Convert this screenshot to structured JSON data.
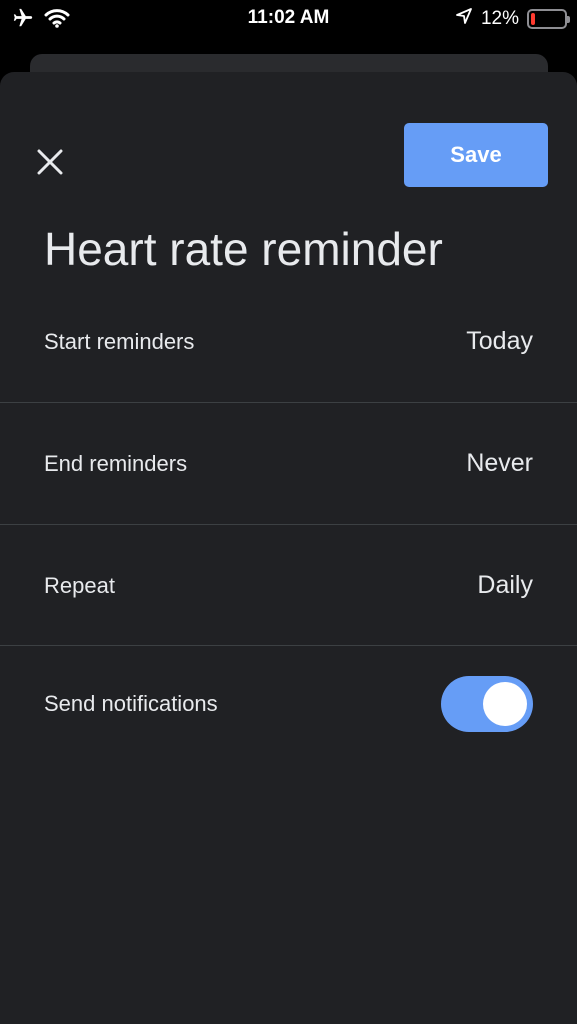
{
  "status_bar": {
    "time": "11:02 AM",
    "battery_percent": "12%",
    "battery_level": 0.12,
    "icons": [
      "airplane-icon",
      "wifi-icon",
      "location-arrow-icon",
      "battery-icon"
    ]
  },
  "header": {
    "close_icon": "close-icon",
    "save_label": "Save"
  },
  "title": "Heart rate reminder",
  "settings": [
    {
      "label": "Start reminders",
      "value": "Today"
    },
    {
      "label": "End reminders",
      "value": "Never"
    },
    {
      "label": "Repeat",
      "value": "Daily"
    }
  ],
  "notifications": {
    "label": "Send notifications",
    "enabled": true
  },
  "colors": {
    "accent": "#669df6",
    "sheet_background": "#202124",
    "divider": "#3c4043",
    "text": "#e8eaed"
  }
}
